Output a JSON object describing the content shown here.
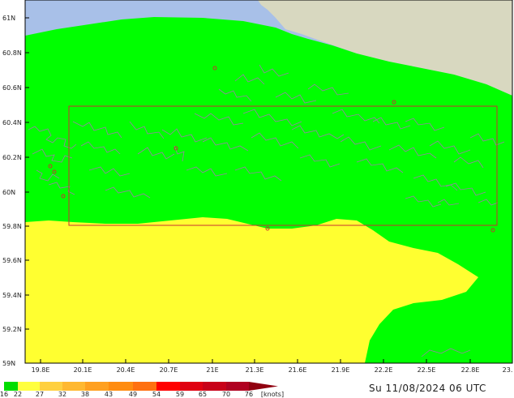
{
  "map": {
    "lat_labels": [
      "61N",
      "60.8N",
      "60.6N",
      "60.4N",
      "60.2N",
      "60N",
      "59.8N",
      "59.6N",
      "59.4N",
      "59.2N",
      "59N"
    ],
    "lon_labels": [
      "19.8E",
      "20.1E",
      "20.4E",
      "20.7E",
      "21E",
      "21.3E",
      "21.6E",
      "21.9E",
      "22.2E",
      "22.5E",
      "22.8E",
      "23."
    ],
    "colors": {
      "sea_no_data": "#a8c0e8",
      "land": "#d8d8c0",
      "wind_16_22": "#00ff00",
      "wind_22_27": "#ffff30",
      "coastline": "#9a80a8",
      "box_outline": "#c83030",
      "grid_tick": "#000000"
    }
  },
  "legend": {
    "labels": [
      "16",
      "22",
      "27",
      "32",
      "38",
      "43",
      "49",
      "54",
      "59",
      "65",
      "70",
      "76"
    ],
    "unit": "[knots]",
    "colors": [
      "#00dd00",
      "#ffff40",
      "#ffd040",
      "#ffb830",
      "#ffa020",
      "#ff8c10",
      "#ff7010",
      "#ff0000",
      "#e00010",
      "#c80018",
      "#b00020",
      "#900010"
    ]
  },
  "timestamp": "Su 11/08/2024 06 UTC"
}
